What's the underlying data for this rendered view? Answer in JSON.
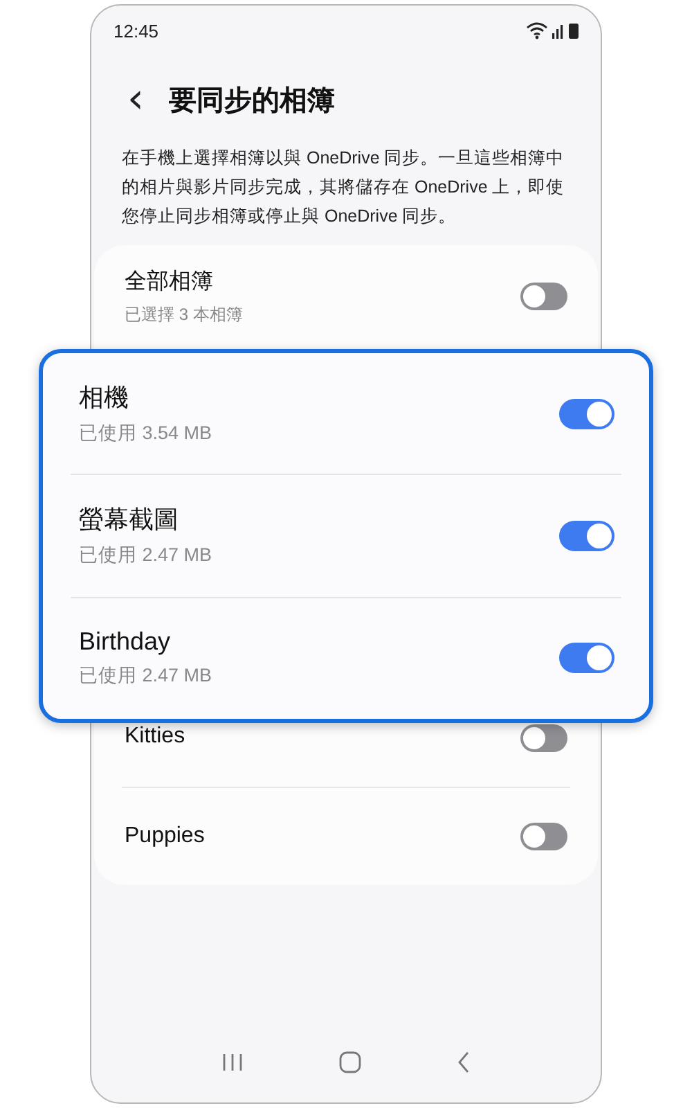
{
  "status_bar": {
    "time": "12:45"
  },
  "header": {
    "back": "‹",
    "title": "要同步的相簿"
  },
  "description": "在手機上選擇相簿以與 OneDrive 同步。一旦這些相簿中的相片與影片同步完成，其將儲存在 OneDrive 上，即使您停止同步相簿或停止與 OneDrive 同步。",
  "all_albums": {
    "title": "全部相簿",
    "subtitle": "已選擇 3 本相簿",
    "on": false
  },
  "highlighted_albums": [
    {
      "title": "相機",
      "subtitle": "已使用 3.54 MB",
      "on": true
    },
    {
      "title": "螢幕截圖",
      "subtitle": "已使用 2.47 MB",
      "on": true
    },
    {
      "title": "Birthday",
      "subtitle": "已使用 2.47 MB",
      "on": true
    }
  ],
  "other_albums": [
    {
      "title": "Kitties",
      "on": false
    },
    {
      "title": "Puppies",
      "on": false
    }
  ]
}
